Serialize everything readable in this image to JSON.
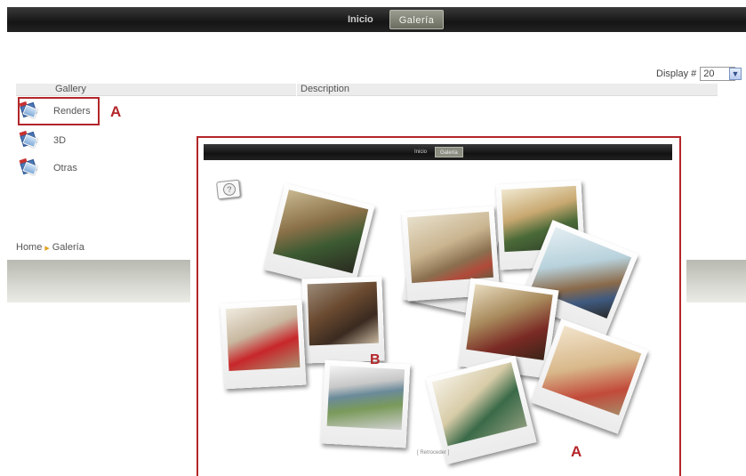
{
  "nav": {
    "items": [
      {
        "label": "Inicio",
        "active": false
      },
      {
        "label": "Galería",
        "active": true
      }
    ]
  },
  "display": {
    "label": "Display #",
    "value": "20"
  },
  "table": {
    "headers": [
      "Gallery",
      "Description"
    ]
  },
  "galleries": [
    {
      "label": "Renders",
      "icon": "photo-album-icon"
    },
    {
      "label": "3D",
      "icon": "photo-album-icon"
    },
    {
      "label": "Otras",
      "icon": "photo-album-icon"
    }
  ],
  "breadcrumb": {
    "home": "Home",
    "current": "Galería"
  },
  "annotations": {
    "a1": "A",
    "a2": "A",
    "b": "B"
  },
  "inner": {
    "nav": [
      "Inicio",
      "Galería"
    ],
    "back_link": "[ Retroceder ]",
    "photos": [
      {
        "name": "render-living-room-green-sofa"
      },
      {
        "name": "render-lounge-window"
      },
      {
        "name": "render-bedroom-window"
      },
      {
        "name": "render-bedroom-blue"
      },
      {
        "name": "render-office-desk"
      },
      {
        "name": "render-kitchen-red"
      },
      {
        "name": "render-dining-room"
      },
      {
        "name": "render-room-red-chairs"
      },
      {
        "name": "render-building-exterior"
      },
      {
        "name": "render-green-sofa-bright"
      }
    ]
  },
  "colors": {
    "annotation": "#b3262a",
    "nav_active": "#8a8c7f"
  }
}
